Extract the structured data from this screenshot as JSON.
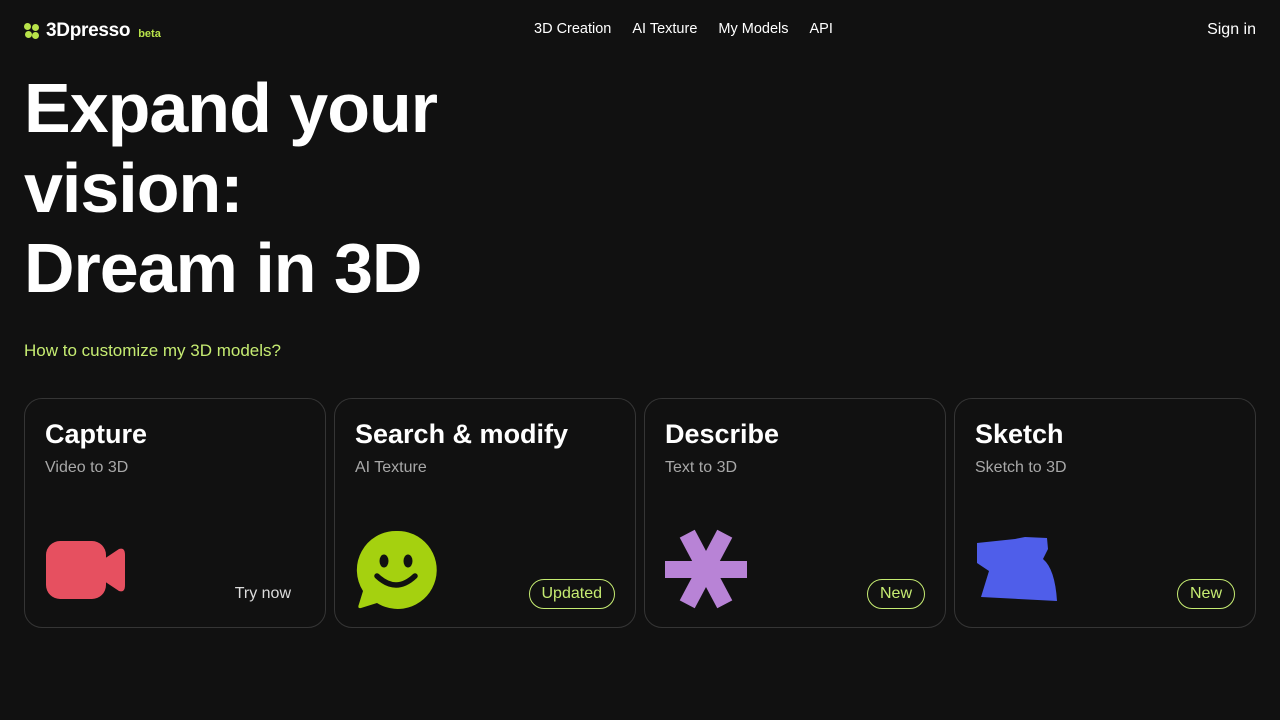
{
  "header": {
    "logo_name": "3Dpresso",
    "logo_badge": "beta",
    "nav": [
      "3D Creation",
      "AI Texture",
      "My Models",
      "API"
    ],
    "sign_in": "Sign in"
  },
  "hero": {
    "line1": "Expand your",
    "line2": "vision:",
    "line3": "Dream in 3D"
  },
  "help_link": "How to customize my 3D models?",
  "cards": [
    {
      "title": "Capture",
      "subtitle": "Video to 3D",
      "action": "Try now",
      "icon": "video-camera-icon",
      "icon_color": "#e65060"
    },
    {
      "title": "Search & modify",
      "subtitle": "AI Texture",
      "action": "Updated",
      "icon": "smiley-chat-icon",
      "icon_color": "#a5d10f"
    },
    {
      "title": "Describe",
      "subtitle": "Text to 3D",
      "action": "New",
      "icon": "asterisk-icon",
      "icon_color": "#b883d6"
    },
    {
      "title": "Sketch",
      "subtitle": "Sketch to 3D",
      "action": "New",
      "icon": "sketch-shape-icon",
      "icon_color": "#4f5eea"
    }
  ],
  "colors": {
    "background": "#111111",
    "accent": "#c6ec72",
    "card_border": "#353535"
  }
}
